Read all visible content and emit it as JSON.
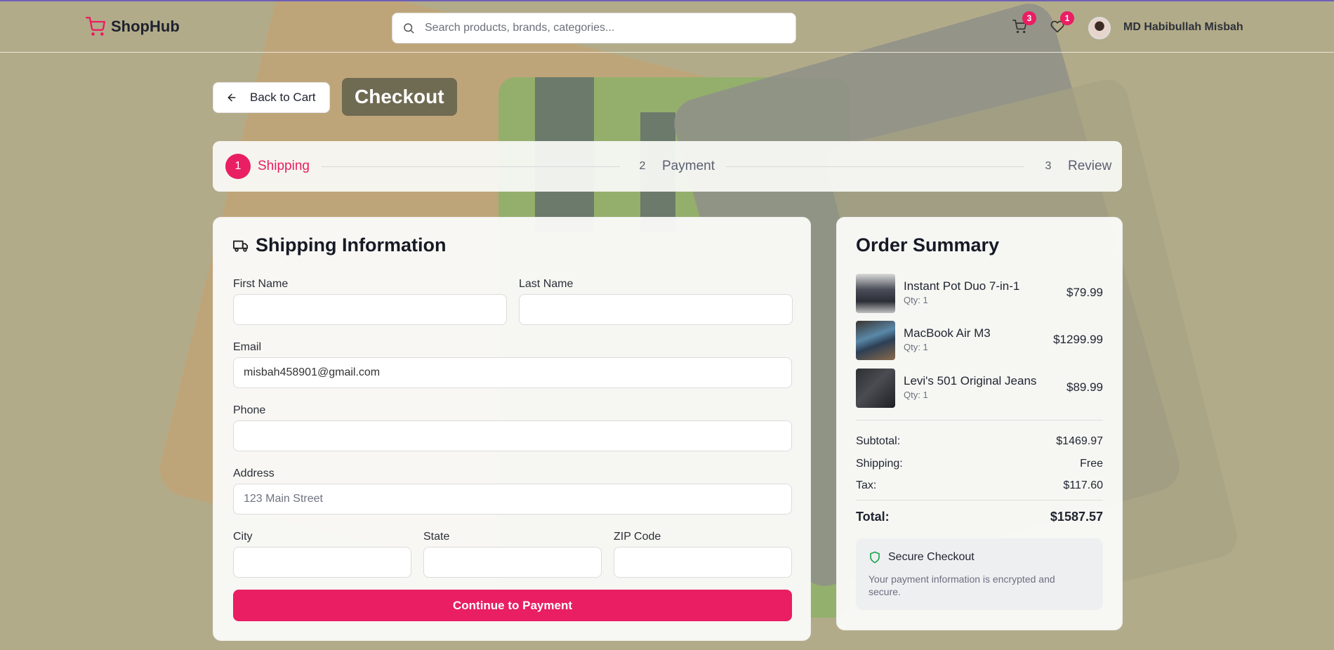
{
  "brand": {
    "name": "ShopHub",
    "accent": "#e91e63"
  },
  "search": {
    "placeholder": "Search products, brands, categories..."
  },
  "header": {
    "cart_badge": "3",
    "wishlist_badge": "1",
    "user_name": "MD Habibullah Misbah"
  },
  "page": {
    "back_label": "Back to Cart",
    "title": "Checkout"
  },
  "steps": [
    {
      "num": "1",
      "label": "Shipping",
      "active": true
    },
    {
      "num": "2",
      "label": "Payment",
      "active": false
    },
    {
      "num": "3",
      "label": "Review",
      "active": false
    }
  ],
  "shipping": {
    "title": "Shipping Information",
    "first_name_label": "First Name",
    "first_name_value": "",
    "last_name_label": "Last Name",
    "last_name_value": "",
    "email_label": "Email",
    "email_value": "misbah458901@gmail.com",
    "phone_label": "Phone",
    "phone_value": "",
    "address_label": "Address",
    "address_placeholder": "123 Main Street",
    "city_label": "City",
    "state_label": "State",
    "zip_label": "ZIP Code",
    "submit_label": "Continue to Payment"
  },
  "summary": {
    "title": "Order Summary",
    "items": [
      {
        "name": "Instant Pot Duo 7-in-1",
        "qty": "Qty: 1",
        "price": "$79.99"
      },
      {
        "name": "MacBook Air M3",
        "qty": "Qty: 1",
        "price": "$1299.99"
      },
      {
        "name": "Levi's 501 Original Jeans",
        "qty": "Qty: 1",
        "price": "$89.99"
      }
    ],
    "subtotal_label": "Subtotal:",
    "subtotal_value": "$1469.97",
    "shipping_label": "Shipping:",
    "shipping_value": "Free",
    "tax_label": "Tax:",
    "tax_value": "$117.60",
    "total_label": "Total:",
    "total_value": "$1587.57",
    "secure_title": "Secure Checkout",
    "secure_desc": "Your payment information is encrypted and secure."
  }
}
